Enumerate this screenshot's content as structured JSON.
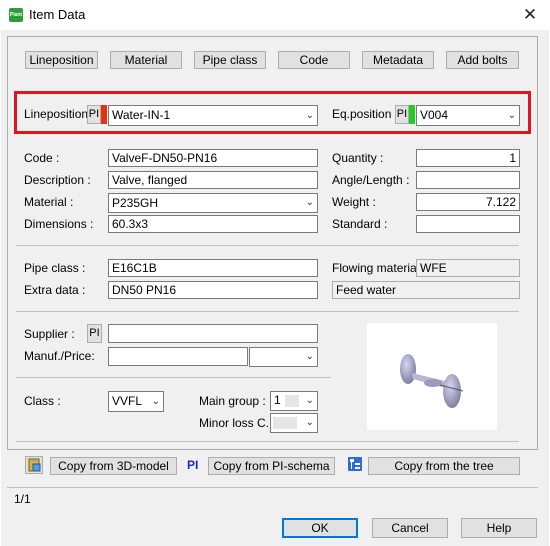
{
  "window": {
    "title": "Item Data",
    "app_icon_text": "Plant",
    "close_glyph": "✕"
  },
  "tabs": [
    "Lineposition",
    "Material",
    "Pipe class",
    "Code",
    "Metadata",
    "Add bolts"
  ],
  "position_row": {
    "lineposition_label": "Lineposition :",
    "lineposition_tag": "PI",
    "lineposition_color": "#e8320e",
    "lineposition_value": "Water-IN-1",
    "eqposition_label": "Eq.position :",
    "eqposition_tag": "PI",
    "eqposition_color": "#22cc22",
    "eqposition_value": "V004"
  },
  "item": {
    "code_label": "Code :",
    "code_value": "ValveF-DN50-PN16",
    "description_label": "Description :",
    "description_value": "Valve, flanged",
    "material_label": "Material :",
    "material_value": "P235GH",
    "dimensions_label": "Dimensions :",
    "dimensions_value": "60.3x3",
    "quantity_label": "Quantity :",
    "quantity_value": "1",
    "angle_label": "Angle/Length :",
    "angle_value": "",
    "weight_label": "Weight :",
    "weight_value": "7.122",
    "standard_label": "Standard :",
    "standard_value": ""
  },
  "pipe": {
    "pipe_class_label": "Pipe class :",
    "pipe_class_value": "E16C1B",
    "extra_data_label": "Extra data :",
    "extra_data_value": "DN50 PN16",
    "flowing_label": "Flowing material :",
    "flowing_value": "WFE",
    "flowing_desc": "Feed water"
  },
  "supplier": {
    "supplier_label": "Supplier :",
    "supplier_tag": "PI",
    "supplier_value": "",
    "manuf_label": "Manuf./Price:",
    "manuf_value": "",
    "price_value": ""
  },
  "classify": {
    "class_label": "Class :",
    "class_value": "VVFL",
    "main_group_label": "Main group :",
    "main_group_value": "1",
    "minor_loss_label": "Minor loss C. :",
    "minor_loss_value": ""
  },
  "copy_row": {
    "copy_3d": "Copy from 3D-model",
    "pi_tag": "PI",
    "copy_pi": "Copy from PI-schema",
    "copy_tree": "Copy from the tree"
  },
  "status": {
    "counter": "1/1"
  },
  "footer": {
    "ok": "OK",
    "cancel": "Cancel",
    "help": "Help"
  }
}
